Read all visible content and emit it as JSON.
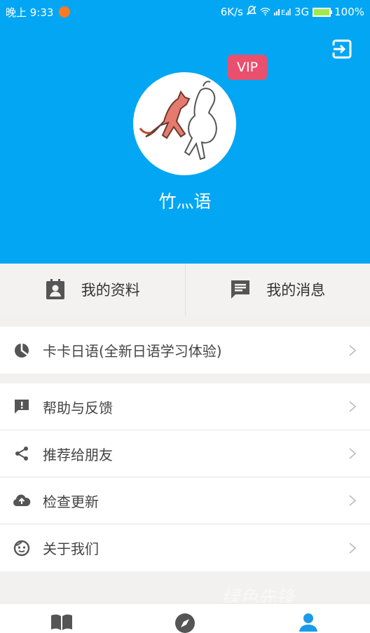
{
  "status_bar": {
    "time": "晚上 9:33",
    "network_speed": "6K/s",
    "network_type": "3G",
    "battery": "100%",
    "battery_level": 1.0
  },
  "header": {
    "vip_label": "VIP",
    "username": "竹灬语",
    "logout_icon": "logout-icon"
  },
  "quick_actions": [
    {
      "label": "我的资料",
      "icon": "contact-card-icon"
    },
    {
      "label": "我的消息",
      "icon": "message-icon"
    }
  ],
  "menu_groups": [
    [
      {
        "label": "卡卡日语(全新日语学习体验)",
        "icon": "app-logo-icon"
      }
    ],
    [
      {
        "label": "帮助与反馈",
        "icon": "feedback-icon"
      },
      {
        "label": "推荐给朋友",
        "icon": "share-icon"
      },
      {
        "label": "检查更新",
        "icon": "cloud-upload-icon"
      },
      {
        "label": "关于我们",
        "icon": "smiley-icon"
      }
    ]
  ],
  "watermark": "绿色先锋",
  "bottom_nav": [
    {
      "icon": "book-icon",
      "active": false
    },
    {
      "icon": "compass-icon",
      "active": false
    },
    {
      "icon": "person-icon",
      "active": true
    }
  ],
  "colors": {
    "header_bg": "#03a6f3",
    "vip_bg": "#e9506e",
    "active_nav": "#1a9be8",
    "inactive_nav": "#555555"
  }
}
